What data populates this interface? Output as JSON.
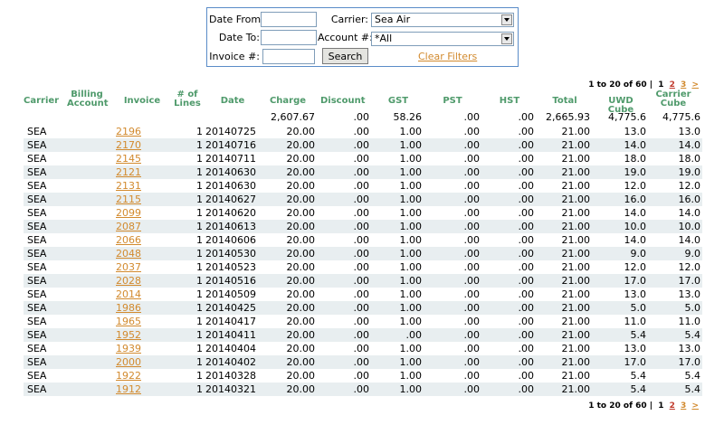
{
  "filters": {
    "date_from_label": "Date From:",
    "date_from_value": "",
    "date_to_label": "Date To:",
    "date_to_value": "",
    "invoice_label": "Invoice #:",
    "invoice_value": "",
    "carrier_label": "Carrier:",
    "carrier_value": "Sea Air",
    "account_label": "Account #:",
    "account_value": "*All",
    "search_label": "Search",
    "clear_label": "Clear Filters"
  },
  "pager": {
    "summary": "1 to 20 of 60",
    "separator": "|",
    "pages": [
      "1",
      "2",
      "3"
    ],
    "next": ">"
  },
  "headers": {
    "carrier": "Carrier",
    "billing_1": "Billing",
    "billing_2": "Account",
    "invoice": "Invoice",
    "lines_1": "# of",
    "lines_2": "Lines",
    "date": "Date",
    "charge": "Charge",
    "discount": "Discount",
    "gst": "GST",
    "pst": "PST",
    "hst": "HST",
    "total": "Total",
    "uwd": "UWD Cube",
    "carrier_cube_1": "Carrier",
    "carrier_cube_2": "Cube"
  },
  "totals": {
    "charge": "2,607.67",
    "discount": ".00",
    "gst": "58.26",
    "pst": ".00",
    "hst": ".00",
    "total": "2,665.93",
    "uwd": "4,775.6",
    "carrier_cube": "4,775.6"
  },
  "rows": [
    {
      "carrier": "SEA",
      "invoice": "2196",
      "lines": "1",
      "date": "20140725",
      "charge": "20.00",
      "discount": ".00",
      "gst": "1.00",
      "pst": ".00",
      "hst": ".00",
      "total": "21.00",
      "uwd": "13.0",
      "cube": "13.0"
    },
    {
      "carrier": "SEA",
      "invoice": "2170",
      "lines": "1",
      "date": "20140716",
      "charge": "20.00",
      "discount": ".00",
      "gst": "1.00",
      "pst": ".00",
      "hst": ".00",
      "total": "21.00",
      "uwd": "14.0",
      "cube": "14.0"
    },
    {
      "carrier": "SEA",
      "invoice": "2145",
      "lines": "1",
      "date": "20140711",
      "charge": "20.00",
      "discount": ".00",
      "gst": "1.00",
      "pst": ".00",
      "hst": ".00",
      "total": "21.00",
      "uwd": "18.0",
      "cube": "18.0"
    },
    {
      "carrier": "SEA",
      "invoice": "2121",
      "lines": "1",
      "date": "20140630",
      "charge": "20.00",
      "discount": ".00",
      "gst": "1.00",
      "pst": ".00",
      "hst": ".00",
      "total": "21.00",
      "uwd": "19.0",
      "cube": "19.0"
    },
    {
      "carrier": "SEA",
      "invoice": "2131",
      "lines": "1",
      "date": "20140630",
      "charge": "20.00",
      "discount": ".00",
      "gst": "1.00",
      "pst": ".00",
      "hst": ".00",
      "total": "21.00",
      "uwd": "12.0",
      "cube": "12.0"
    },
    {
      "carrier": "SEA",
      "invoice": "2115",
      "lines": "1",
      "date": "20140627",
      "charge": "20.00",
      "discount": ".00",
      "gst": "1.00",
      "pst": ".00",
      "hst": ".00",
      "total": "21.00",
      "uwd": "16.0",
      "cube": "16.0"
    },
    {
      "carrier": "SEA",
      "invoice": "2099",
      "lines": "1",
      "date": "20140620",
      "charge": "20.00",
      "discount": ".00",
      "gst": "1.00",
      "pst": ".00",
      "hst": ".00",
      "total": "21.00",
      "uwd": "14.0",
      "cube": "14.0"
    },
    {
      "carrier": "SEA",
      "invoice": "2087",
      "lines": "1",
      "date": "20140613",
      "charge": "20.00",
      "discount": ".00",
      "gst": "1.00",
      "pst": ".00",
      "hst": ".00",
      "total": "21.00",
      "uwd": "10.0",
      "cube": "10.0"
    },
    {
      "carrier": "SEA",
      "invoice": "2066",
      "lines": "1",
      "date": "20140606",
      "charge": "20.00",
      "discount": ".00",
      "gst": "1.00",
      "pst": ".00",
      "hst": ".00",
      "total": "21.00",
      "uwd": "14.0",
      "cube": "14.0"
    },
    {
      "carrier": "SEA",
      "invoice": "2048",
      "lines": "1",
      "date": "20140530",
      "charge": "20.00",
      "discount": ".00",
      "gst": "1.00",
      "pst": ".00",
      "hst": ".00",
      "total": "21.00",
      "uwd": "9.0",
      "cube": "9.0"
    },
    {
      "carrier": "SEA",
      "invoice": "2037",
      "lines": "1",
      "date": "20140523",
      "charge": "20.00",
      "discount": ".00",
      "gst": "1.00",
      "pst": ".00",
      "hst": ".00",
      "total": "21.00",
      "uwd": "12.0",
      "cube": "12.0"
    },
    {
      "carrier": "SEA",
      "invoice": "2028",
      "lines": "1",
      "date": "20140516",
      "charge": "20.00",
      "discount": ".00",
      "gst": "1.00",
      "pst": ".00",
      "hst": ".00",
      "total": "21.00",
      "uwd": "17.0",
      "cube": "17.0"
    },
    {
      "carrier": "SEA",
      "invoice": "2014",
      "lines": "1",
      "date": "20140509",
      "charge": "20.00",
      "discount": ".00",
      "gst": "1.00",
      "pst": ".00",
      "hst": ".00",
      "total": "21.00",
      "uwd": "13.0",
      "cube": "13.0"
    },
    {
      "carrier": "SEA",
      "invoice": "1986",
      "lines": "1",
      "date": "20140425",
      "charge": "20.00",
      "discount": ".00",
      "gst": "1.00",
      "pst": ".00",
      "hst": ".00",
      "total": "21.00",
      "uwd": "5.0",
      "cube": "5.0"
    },
    {
      "carrier": "SEA",
      "invoice": "1965",
      "lines": "1",
      "date": "20140417",
      "charge": "20.00",
      "discount": ".00",
      "gst": "1.00",
      "pst": ".00",
      "hst": ".00",
      "total": "21.00",
      "uwd": "11.0",
      "cube": "11.0"
    },
    {
      "carrier": "SEA",
      "invoice": "1952",
      "lines": "1",
      "date": "20140411",
      "charge": "20.00",
      "discount": ".00",
      "gst": ".00",
      "pst": ".00",
      "hst": ".00",
      "total": "21.00",
      "uwd": "5.4",
      "cube": "5.4"
    },
    {
      "carrier": "SEA",
      "invoice": "1939",
      "lines": "1",
      "date": "20140404",
      "charge": "20.00",
      "discount": ".00",
      "gst": "1.00",
      "pst": ".00",
      "hst": ".00",
      "total": "21.00",
      "uwd": "13.0",
      "cube": "13.0"
    },
    {
      "carrier": "SEA",
      "invoice": "2000",
      "lines": "1",
      "date": "20140402",
      "charge": "20.00",
      "discount": ".00",
      "gst": "1.00",
      "pst": ".00",
      "hst": ".00",
      "total": "21.00",
      "uwd": "17.0",
      "cube": "17.0"
    },
    {
      "carrier": "SEA",
      "invoice": "1922",
      "lines": "1",
      "date": "20140328",
      "charge": "20.00",
      "discount": ".00",
      "gst": "1.00",
      "pst": ".00",
      "hst": ".00",
      "total": "21.00",
      "uwd": "5.4",
      "cube": "5.4"
    },
    {
      "carrier": "SEA",
      "invoice": "1912",
      "lines": "1",
      "date": "20140321",
      "charge": "20.00",
      "discount": ".00",
      "gst": "1.00",
      "pst": ".00",
      "hst": ".00",
      "total": "21.00",
      "uwd": "5.4",
      "cube": "5.4"
    }
  ],
  "colors": {
    "header_text": "#4f9a6b",
    "link": "#d28a2e",
    "row_alt": "#e8eef0",
    "filter_border": "#5a8cc8"
  }
}
